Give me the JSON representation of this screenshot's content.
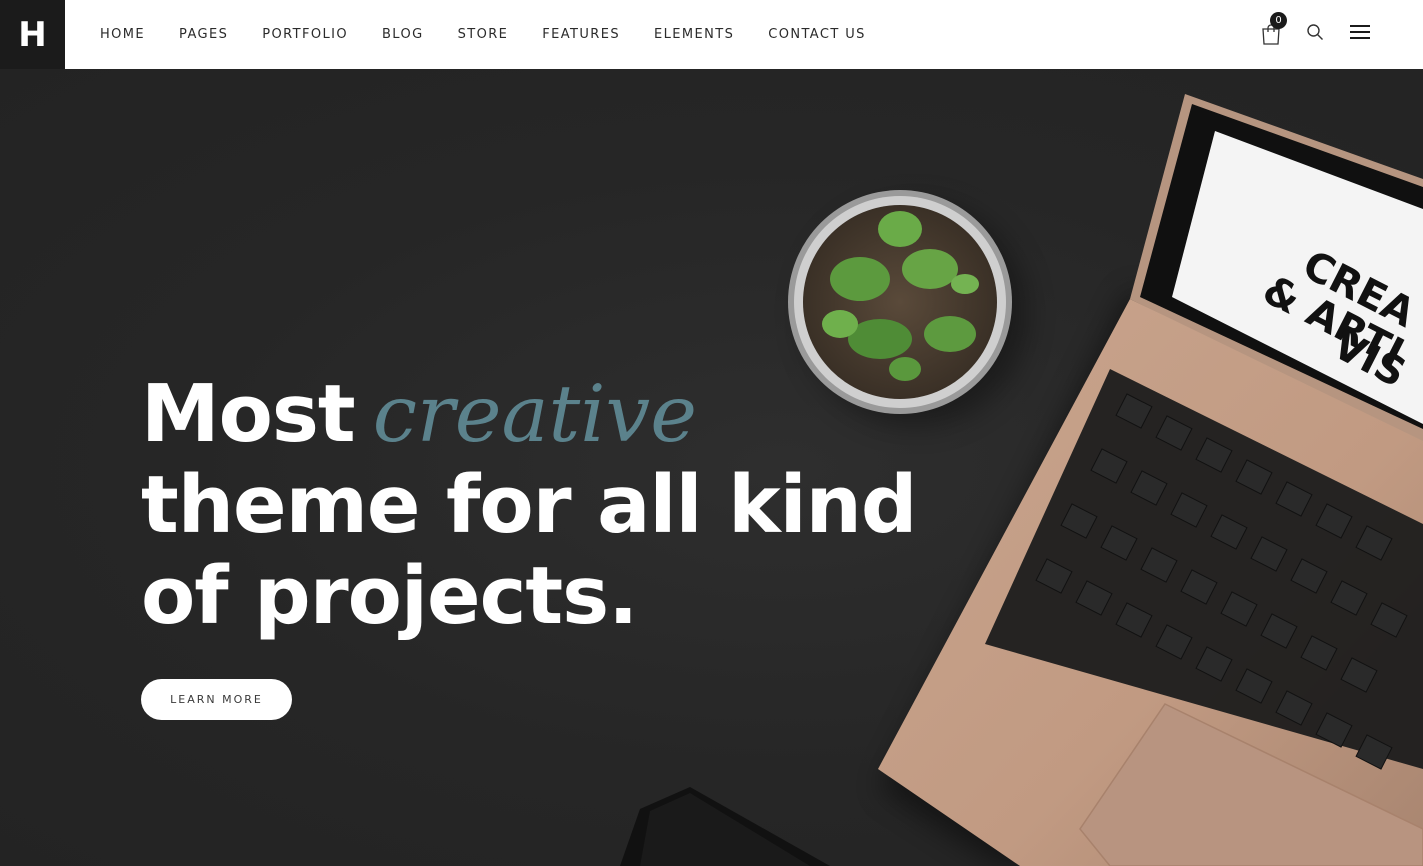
{
  "logo": {
    "letter": "H"
  },
  "nav": {
    "items": [
      {
        "label": "HOME"
      },
      {
        "label": "PAGES"
      },
      {
        "label": "PORTFOLIO"
      },
      {
        "label": "BLOG"
      },
      {
        "label": "STORE"
      },
      {
        "label": "FEATURES"
      },
      {
        "label": "ELEMENTS"
      },
      {
        "label": "CONTACT US"
      }
    ]
  },
  "cart": {
    "count": "0"
  },
  "icons": {
    "cart": "shopping-bag-icon",
    "search": "search-icon",
    "menu": "hamburger-menu-icon"
  },
  "hero": {
    "line1_word": "Most",
    "line1_accent": "creative",
    "line2": "theme for all kind",
    "line3": "of projects.",
    "button_label": "LEARN MORE"
  },
  "colors": {
    "background": "#262626",
    "accent": "#5b828c",
    "header": "#ffffff",
    "logo_bg": "#1b1b1b"
  }
}
